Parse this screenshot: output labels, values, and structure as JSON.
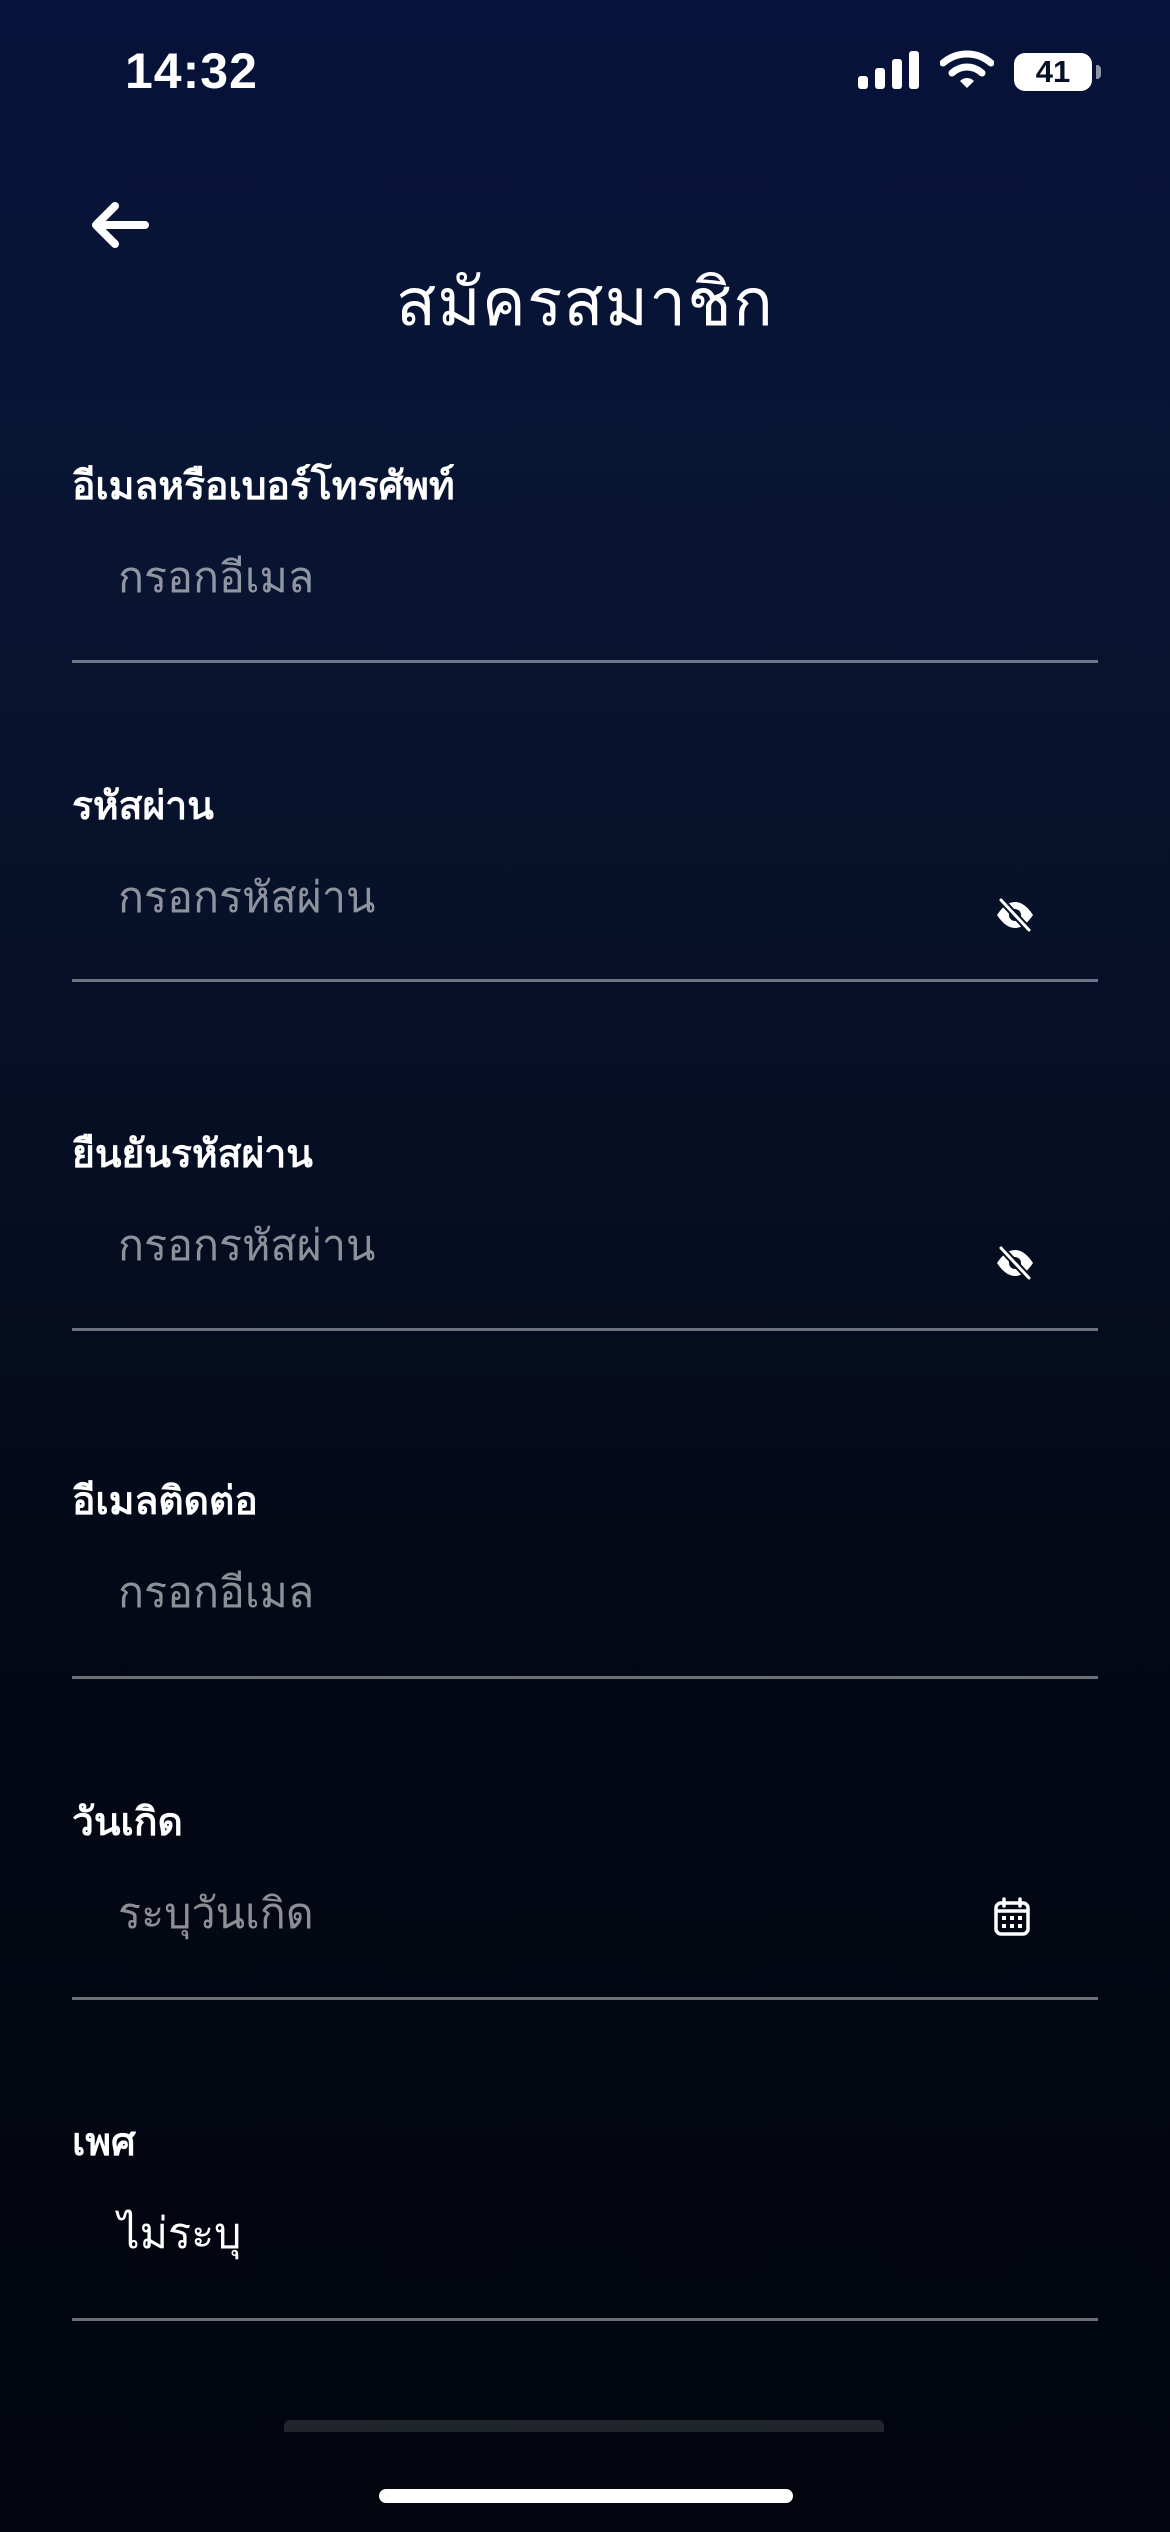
{
  "status_bar": {
    "time": "14:32",
    "battery": "41",
    "icons": [
      "signal-icon",
      "wifi-icon",
      "battery-icon"
    ]
  },
  "header": {
    "title": "สมัครสมาชิก",
    "back_icon": "arrow-left-icon"
  },
  "form": {
    "email_or_phone": {
      "label": "อีเมลหรือเบอร์โทรศัพท์",
      "placeholder": "กรอกอีเมล"
    },
    "password": {
      "label": "รหัสผ่าน",
      "placeholder": "กรอกรหัสผ่าน",
      "icon": "eye-slash-icon"
    },
    "confirm_password": {
      "label": "ยืนยันรหัสผ่าน",
      "placeholder": "กรอกรหัสผ่าน",
      "icon": "eye-slash-icon"
    },
    "contact_email": {
      "label": "อีเมลติดต่อ",
      "placeholder": "กรอกอีเมล"
    },
    "birthday": {
      "label": "วันเกิด",
      "placeholder": "ระบุวันเกิด",
      "icon": "calendar-icon"
    },
    "gender": {
      "label": "เพศ",
      "value": "ไม่ระบุ"
    }
  },
  "colors": {
    "background_top": "#07123a",
    "background_bottom": "#02050d",
    "text": "#ffffff",
    "placeholder": "#8e95a3",
    "divider": "#6c7480"
  }
}
